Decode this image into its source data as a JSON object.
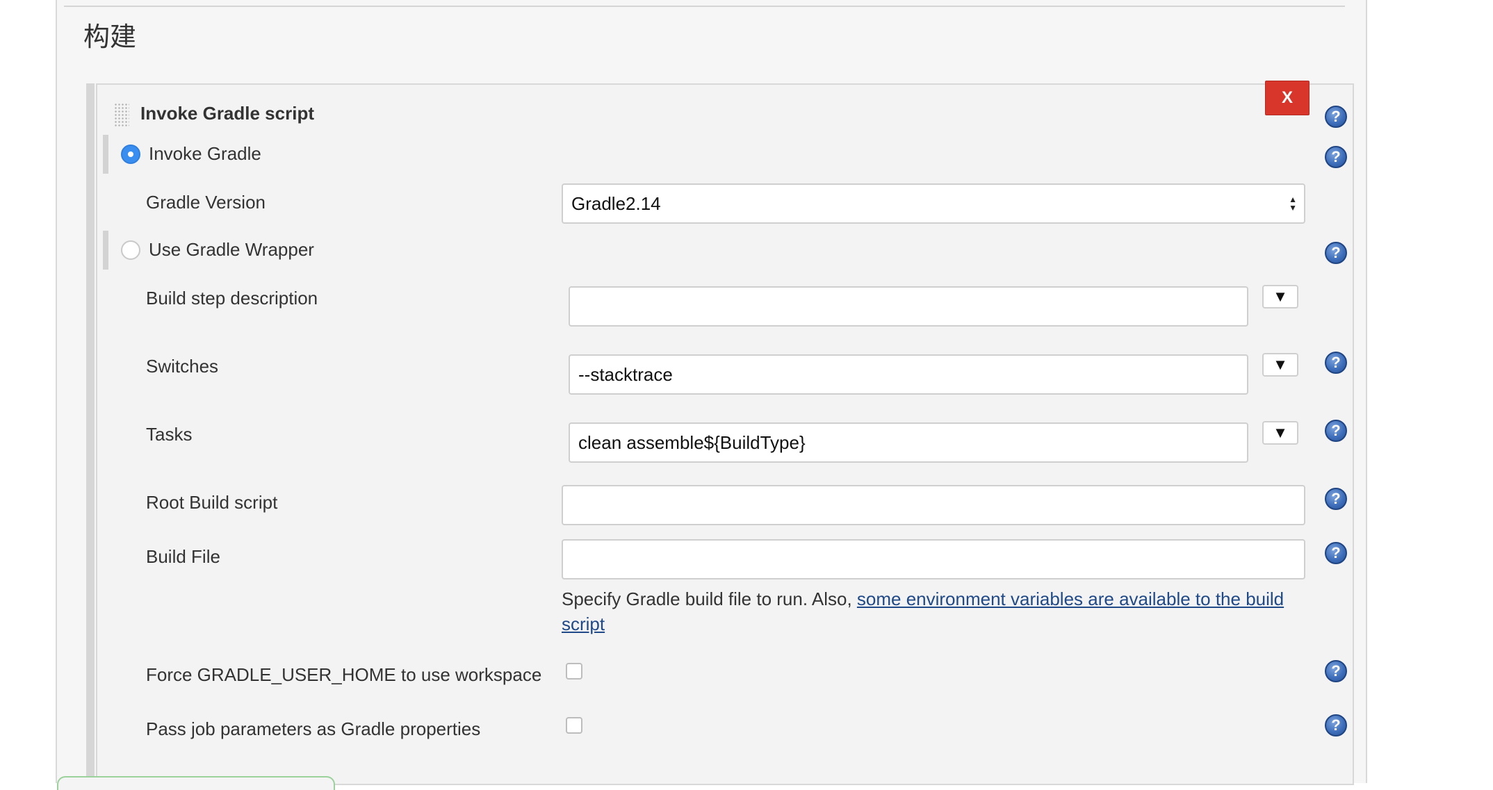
{
  "section": {
    "title": "构建"
  },
  "step": {
    "title": "Invoke Gradle script",
    "close_label": "X",
    "invoke_gradle": {
      "label": "Invoke Gradle",
      "selected": true
    },
    "gradle_version": {
      "label": "Gradle Version",
      "value": "Gradle2.14"
    },
    "use_wrapper": {
      "label": "Use Gradle Wrapper",
      "selected": false
    },
    "build_step_description": {
      "label": "Build step description",
      "value": ""
    },
    "switches": {
      "label": "Switches",
      "value": "--stacktrace"
    },
    "tasks": {
      "label": "Tasks",
      "value": "clean assemble${BuildType}"
    },
    "root_build_script": {
      "label": "Root Build script",
      "value": ""
    },
    "build_file": {
      "label": "Build File",
      "value": "",
      "help_text": "Specify Gradle build file to run. Also, ",
      "help_link": "some environment variables are available to the build script"
    },
    "force_gradle_user_home": {
      "label": "Force GRADLE_USER_HOME to use workspace",
      "checked": false
    },
    "pass_job_parameters": {
      "label": "Pass job parameters as Gradle properties",
      "checked": false
    }
  },
  "icons": {
    "help": "?",
    "expand": "▼",
    "select_up": "▲",
    "select_down": "▼"
  },
  "colors": {
    "close_button": "#d9362b",
    "radio_selected": "#3a8ef0",
    "help_icon": "#3f6fbb",
    "link": "#204a87"
  }
}
